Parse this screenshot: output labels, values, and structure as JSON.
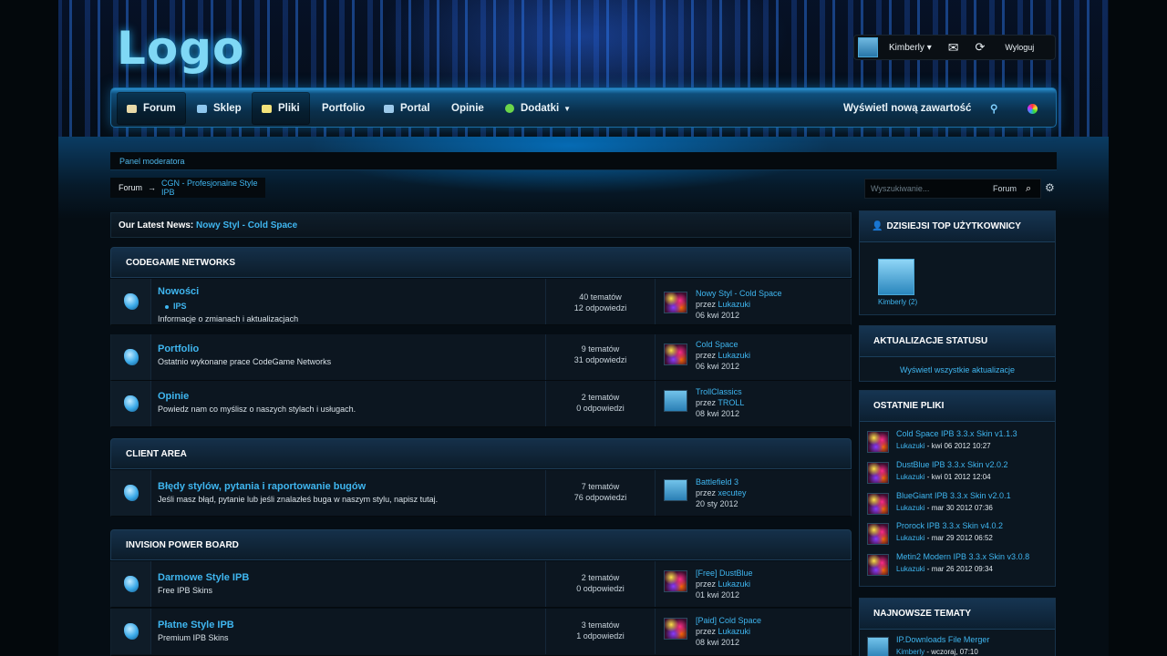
{
  "logo": "Logo",
  "user": {
    "name": "Kimberly",
    "logout": "Wyloguj"
  },
  "nav": {
    "items": [
      "Forum",
      "Sklep",
      "Pliki",
      "Portfolio",
      "Portal",
      "Opinie",
      "Dodatki"
    ],
    "new_content": "Wyświetl nową zawartość"
  },
  "moderator_panel": "Panel moderatora",
  "breadcrumb": {
    "home": "Forum",
    "current": "CGN - Profesjonalne Style IPB"
  },
  "search": {
    "placeholder": "Wyszukiwanie...",
    "scope": "Forum"
  },
  "news": {
    "label": "Our Latest News:",
    "link": "Nowy Styl - Cold Space"
  },
  "categories": [
    {
      "title": "CODEGAME NETWORKS",
      "forums": [
        {
          "title": "Nowości",
          "sub": "IPS",
          "desc": "Informacje o zmianach i aktualizacjach",
          "topics": "40 tematów",
          "replies": "12 odpowiedzi",
          "last_title": "Nowy Styl - Cold Space",
          "last_by": "przez",
          "last_user": "Lukazuki",
          "last_date": "06 kwi 2012"
        },
        {
          "title": "Portfolio",
          "desc": "Ostatnio wykonane prace CodeGame Networks",
          "topics": "9 tematów",
          "replies": "31 odpowiedzi",
          "last_title": "Cold Space",
          "last_by": "przez",
          "last_user": "Lukazuki",
          "last_date": "06 kwi 2012"
        },
        {
          "title": "Opinie",
          "desc": "Powiedz nam co myślisz o naszych stylach i usługach.",
          "topics": "2 tematów",
          "replies": "0 odpowiedzi",
          "last_title": "TrollClassics",
          "last_by": "przez",
          "last_user": "TROLL",
          "last_date": "08 kwi 2012"
        }
      ]
    },
    {
      "title": "CLIENT AREA",
      "forums": [
        {
          "title": "Błędy stylów, pytania i raportowanie bugów",
          "desc": "Jeśli masz błąd, pytanie lub jeśli znalazłeś buga w naszym stylu, napisz tutaj.",
          "topics": "7 tematów",
          "replies": "76 odpowiedzi",
          "last_title": "Battlefield 3",
          "last_by": "przez",
          "last_user": "xecutey",
          "last_date": "20 sty 2012"
        }
      ]
    },
    {
      "title": "INVISION POWER BOARD",
      "forums": [
        {
          "title": "Darmowe Style IPB",
          "desc": "Free IPB Skins",
          "topics": "2 tematów",
          "replies": "0 odpowiedzi",
          "last_title": "[Free] DustBlue",
          "last_by": "przez",
          "last_user": "Lukazuki",
          "last_date": "01 kwi 2012"
        },
        {
          "title": "Płatne Style IPB",
          "desc": "Premium IPB Skins",
          "topics": "3 tematów",
          "replies": "1 odpowiedzi",
          "last_title": "[Paid] Cold Space",
          "last_by": "przez",
          "last_user": "Lukazuki",
          "last_date": "08 kwi 2012"
        }
      ]
    }
  ],
  "sidebar": {
    "top_users": {
      "title": "DZISIEJSI TOP UŻYTKOWNICY",
      "user": "Kimberly (2)"
    },
    "status": {
      "title": "AKTUALIZACJE STATUSU",
      "link": "Wyświetl wszystkie aktualizacje"
    },
    "files": {
      "title": "OSTATNIE PLIKI",
      "items": [
        {
          "title": "Cold Space IPB 3.3.x Skin v1.1.3",
          "user": "Lukazuki",
          "meta": " - kwi 06 2012 10:27"
        },
        {
          "title": "DustBlue IPB 3.3.x Skin v2.0.2",
          "user": "Lukazuki",
          "meta": " - kwi 01 2012 12:04"
        },
        {
          "title": "BlueGiant IPB 3.3.x Skin v2.0.1",
          "user": "Lukazuki",
          "meta": " - mar 30 2012 07:36"
        },
        {
          "title": "Prorock IPB 3.3.x Skin v4.0.2",
          "user": "Lukazuki",
          "meta": " - mar 29 2012 06:52"
        },
        {
          "title": "Metin2 Modern IPB 3.3.x Skin v3.0.8",
          "user": "Lukazuki",
          "meta": " - mar 26 2012 09:34"
        }
      ]
    },
    "topics": {
      "title": "NAJNOWSZE TEMATY",
      "items": [
        {
          "title": "IP.Downloads File Merger",
          "user": "Kimberly",
          "meta": " - wczoraj, 07:10"
        }
      ]
    }
  },
  "colors": {
    "accent": "#3fb6f0",
    "nav_top": "#2a8fd0",
    "bg": "#050d14"
  }
}
